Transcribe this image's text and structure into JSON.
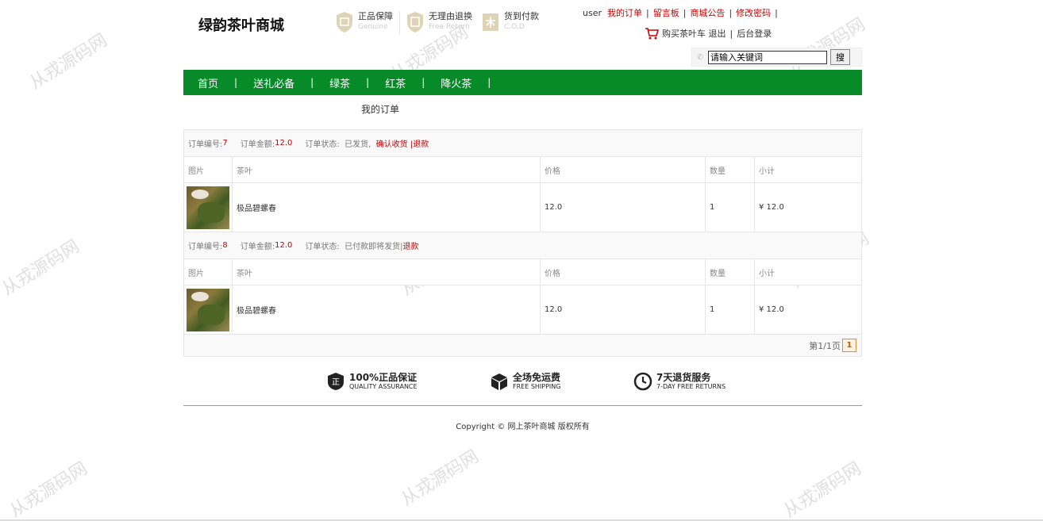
{
  "header": {
    "logo": "绿韵茶叶商城",
    "promos": [
      {
        "title": "正品保障",
        "sub": "Genuine",
        "icon": "shield-genuine-icon"
      },
      {
        "title": "无理由退换",
        "sub": "Free Return",
        "icon": "shield-return-icon"
      },
      {
        "title": "货到付款",
        "sub": "C.O.D",
        "icon": "cod-icon"
      }
    ],
    "topnav": {
      "user": "user",
      "my_orders": "我的订单",
      "message_board": "留言板",
      "notice": "商城公告",
      "change_password": "修改密码"
    },
    "cartline": {
      "cart": "购买茶叶车",
      "logout": "退出",
      "admin": "后台登录"
    },
    "search": {
      "value": "请输入关键词",
      "button": "搜"
    }
  },
  "mainnav": [
    "首页",
    "送礼必备",
    "绿茶",
    "红茶",
    "降火茶"
  ],
  "page_title": "我的订单",
  "columns": [
    "图片",
    "茶叶",
    "价格",
    "数量",
    "小计"
  ],
  "orders": [
    {
      "no_label": "订单编号:",
      "no": "7",
      "amount_label": "订单金额:",
      "amount": "12.0",
      "status_label": "订单状态:",
      "status": "已发货,",
      "action1": "确认收货",
      "action2": "|退款",
      "items": [
        {
          "name": "极品碧螺春",
          "price": "12.0",
          "qty": "1",
          "subtotal": "¥ 12.0"
        }
      ]
    },
    {
      "no_label": "订单编号:",
      "no": "8",
      "amount_label": "订单金额:",
      "amount": "12.0",
      "status_label": "订单状态:",
      "status": "已付款即将发货|",
      "action1": "退款",
      "items": [
        {
          "name": "极品碧螺春",
          "price": "12.0",
          "qty": "1",
          "subtotal": "¥ 12.0"
        }
      ]
    }
  ],
  "pager": {
    "text": "第1/1页",
    "current": "1"
  },
  "services": [
    {
      "title": "100%正品保证",
      "sub": "QUALITY ASSURANCE",
      "icon": "quality-shield-icon"
    },
    {
      "title": "全场免运费",
      "sub": "FREE SHIPPING",
      "icon": "box-icon"
    },
    {
      "title": "7天退货服务",
      "sub": "7-DAY FREE RETURNS",
      "icon": "clock-icon"
    }
  ],
  "copyright": "Copyright © 网上茶叶商城 版权所有",
  "watermark": "从戎源码网",
  "colors": {
    "nav_green": "#078a28",
    "link_red": "#cc0000"
  }
}
